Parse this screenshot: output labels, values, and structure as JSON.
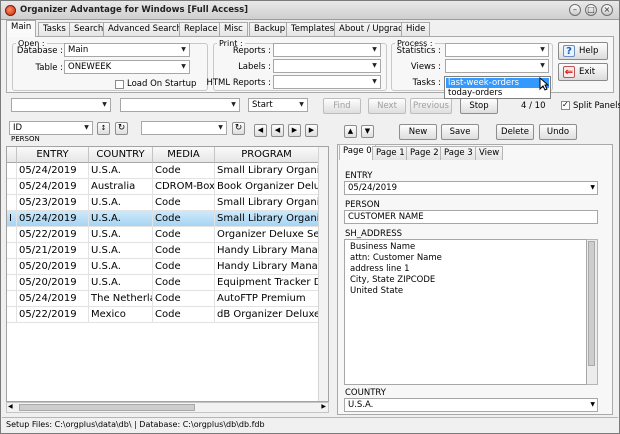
{
  "window": {
    "title": "Organizer Advantage for Windows [Full Access]"
  },
  "tabs": [
    "Main",
    "Tasks",
    "Search",
    "Advanced Search",
    "Replace",
    "Misc",
    "Backup",
    "Templates",
    "About / Upgrade",
    "Hide"
  ],
  "open_group": {
    "title": "Open :",
    "database_label": "Database :",
    "database_value": "Main",
    "table_label": "Table :",
    "table_value": "ONEWEEK",
    "load_on_startup": "Load On Startup"
  },
  "print_group": {
    "title": "Print :",
    "reports_label": "Reports :",
    "labels_label": "Labels :",
    "html_reports_label": "HTML Reports :"
  },
  "process_group": {
    "title": "Process :",
    "statistics_label": "Statistics :",
    "views_label": "Views :",
    "tasks_label": "Tasks :"
  },
  "views_dropdown": {
    "options": [
      "last-week-orders",
      "today-orders"
    ],
    "selected_index": 0
  },
  "buttons": {
    "help": "Help",
    "exit": "Exit"
  },
  "searchbar": {
    "start": "Start",
    "find": "Find",
    "next": "Next",
    "previous": "Previous",
    "stop": "Stop",
    "record_position": "4 / 10",
    "split_panels": "Split Panels"
  },
  "sortbar": {
    "sort_field": "ID",
    "sort_caption": "PERSON"
  },
  "record_buttons": {
    "new": "New",
    "save": "Save",
    "delete": "Delete",
    "undo": "Undo"
  },
  "grid": {
    "columns": [
      "ENTRY",
      "COUNTRY",
      "MEDIA",
      "PROGRAM"
    ],
    "rows": [
      [
        "05/24/2019",
        "U.S.A.",
        "Code",
        "Small Library Organizer"
      ],
      [
        "05/24/2019",
        "Australia",
        "CDROM-Box",
        "Book Organizer Deluxe"
      ],
      [
        "05/23/2019",
        "U.S.A.",
        "Code",
        "Small Library Organizer"
      ],
      [
        "05/24/2019",
        "U.S.A.",
        "Code",
        "Small Library Organizer"
      ],
      [
        "05/22/2019",
        "U.S.A.",
        "Code",
        "Organizer Deluxe Server"
      ],
      [
        "05/21/2019",
        "U.S.A.",
        "Code",
        "Handy Library Manager"
      ],
      [
        "05/20/2019",
        "U.S.A.",
        "Code",
        "Handy Library Manager"
      ],
      [
        "05/20/2019",
        "U.S.A.",
        "Code",
        "Equipment Tracker Deluxe"
      ],
      [
        "05/24/2019",
        "The Netherlands",
        "Code",
        "AutoFTP Premium"
      ],
      [
        "05/22/2019",
        "Mexico",
        "Code",
        "dB Organizer Deluxe"
      ]
    ],
    "selected_row": 3,
    "row_marker": "I"
  },
  "detail_tabs": [
    "Page 0",
    "Page 1",
    "Page 2",
    "Page 3",
    "View"
  ],
  "detail": {
    "entry_label": "ENTRY",
    "entry_value": "05/24/2019",
    "person_label": "PERSON",
    "person_value": "CUSTOMER NAME",
    "address_label": "SH_ADDRESS",
    "address_lines": [
      "Business Name",
      "attn: Customer Name",
      "address line 1",
      "City,  State ZIPCODE",
      "United State"
    ],
    "country_label": "COUNTRY",
    "country_value": "U.S.A."
  },
  "statusbar": {
    "text": "Setup Files: C:\\orgplus\\data\\db\\ | Database: C:\\orgplus\\db\\db.fdb"
  }
}
